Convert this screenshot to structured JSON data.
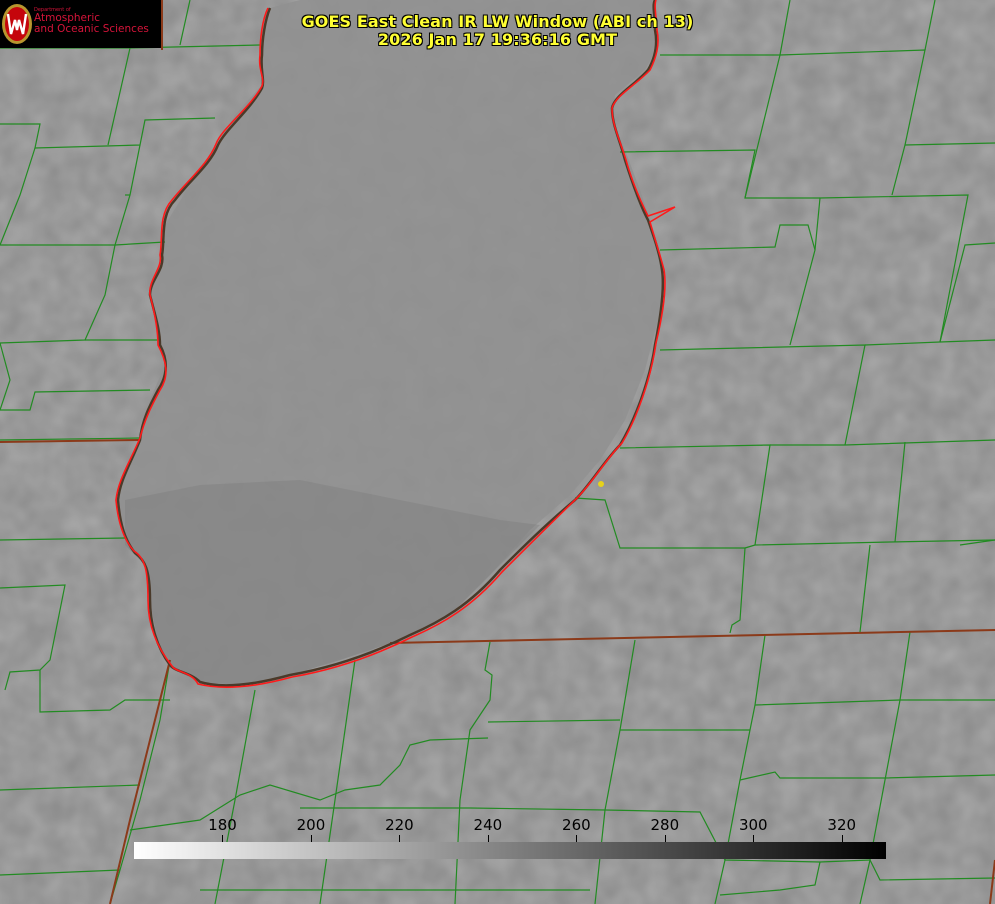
{
  "title": {
    "line1": "GOES East Clean IR LW Window (ABI ch 13)",
    "line2": "2026 Jan 17 19:36:16 GMT"
  },
  "logo": {
    "department": "Department of",
    "line1": "Atmospheric",
    "line2": "and Oceanic Sciences",
    "icon": "uw-crest-icon"
  },
  "colorbar": {
    "min": 160,
    "max": 330,
    "gradient": [
      "#ffffff",
      "#000000"
    ],
    "ticks": [
      "180",
      "200",
      "220",
      "240",
      "260",
      "280",
      "300",
      "320"
    ]
  },
  "colors": {
    "background": "#8a8a8a",
    "lake_surface": "#8e8e8e",
    "county_lines": "#228b22",
    "coastline": "#ff0000",
    "state_border": "#8b3a1a",
    "title_text": "#ffff33",
    "logo_text": "#d6143a",
    "marker": "#e6d21a"
  }
}
